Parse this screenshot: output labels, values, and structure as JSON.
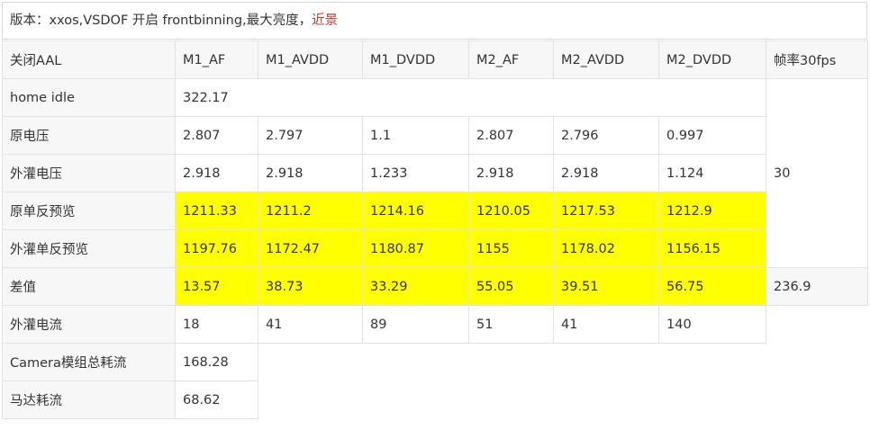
{
  "caption": {
    "prefix": "版本：xxos,VSDOF 开启 frontbinning,最大亮度，",
    "highlight": "近景"
  },
  "table": {
    "header": [
      "关闭AAL",
      "M1_AF",
      "M1_AVDD",
      "M1_DVDD",
      "M2_AF",
      "M2_AVDD",
      "M2_DVDD",
      "帧率30fps"
    ],
    "rows": [
      {
        "label": "home idle",
        "total": "322.17"
      },
      {
        "label": "原电压",
        "values": [
          "2.807",
          "2.797",
          "1.1",
          "2.807",
          "2.796",
          "0.997"
        ]
      },
      {
        "label": "外灌电压",
        "values": [
          "2.918",
          "2.918",
          "1.233",
          "2.918",
          "2.918",
          "1.124"
        ]
      },
      {
        "label": "原单反预览",
        "values": [
          "1211.33",
          "1211.2",
          "1214.16",
          "1210.05",
          "1217.53",
          "1212.9"
        ]
      },
      {
        "label": "外灌单反预览",
        "values": [
          "1197.76",
          "1172.47",
          "1180.87",
          "1155",
          "1178.02",
          "1156.15"
        ]
      },
      {
        "label": "差值",
        "values": [
          "13.57",
          "38.73",
          "33.29",
          "55.05",
          "39.51",
          "56.75"
        ]
      },
      {
        "label": "外灌电流",
        "values": [
          "18",
          "41",
          "89",
          "51",
          "41",
          "140"
        ]
      },
      {
        "label": "Camera模组总耗流",
        "total": "168.28"
      },
      {
        "label": "马达耗流",
        "total": "68.62"
      }
    ],
    "fps_value": "30",
    "diff_total": "236.9",
    "highlight_color": "#ffff00"
  }
}
